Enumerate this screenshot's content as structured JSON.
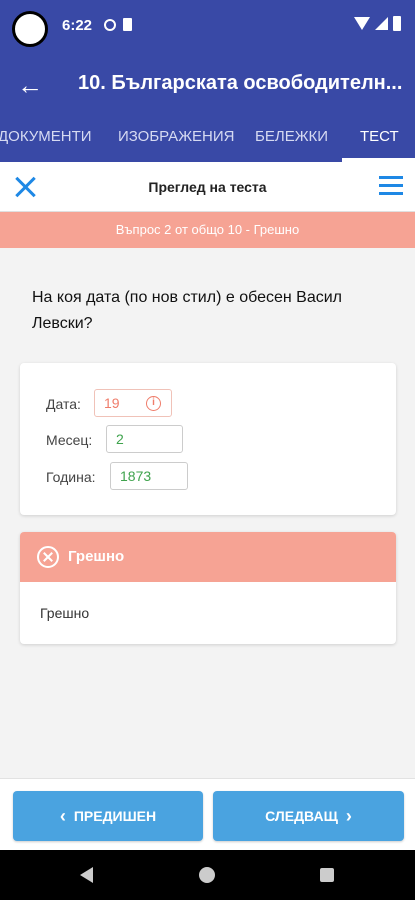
{
  "status_bar": {
    "time": "6:22"
  },
  "app_bar": {
    "title": "10. Българската освободителн..."
  },
  "tabs": [
    {
      "label": "ДОКУМЕНТИ",
      "active": false
    },
    {
      "label": "ИЗОБРАЖЕНИЯ",
      "active": false
    },
    {
      "label": "БЕЛЕЖКИ",
      "active": false
    },
    {
      "label": "ТЕСТ",
      "active": true
    }
  ],
  "toolbar": {
    "title": "Преглед на теста"
  },
  "banner": {
    "text": "Въпрос 2 от общо 10 - Грешно"
  },
  "question": {
    "text": "На коя дата (по нов стил) е обесен Васил Левски?"
  },
  "answer_fields": {
    "day": {
      "label": "Дата:",
      "value": "19",
      "state": "wrong"
    },
    "month": {
      "label": "Месец:",
      "value": "2",
      "state": "correct"
    },
    "year": {
      "label": "Година:",
      "value": "1873",
      "state": "correct"
    }
  },
  "result": {
    "title": "Грешно",
    "text": "Грешно"
  },
  "navigation": {
    "prev_label": "ПРЕДИШЕН",
    "next_label": "СЛЕДВАЩ"
  },
  "colors": {
    "primary": "#3949a6",
    "accent": "#1e88e5",
    "wrong": "#f6a394",
    "correct": "#3fa34d",
    "button": "#4aa3e0"
  }
}
